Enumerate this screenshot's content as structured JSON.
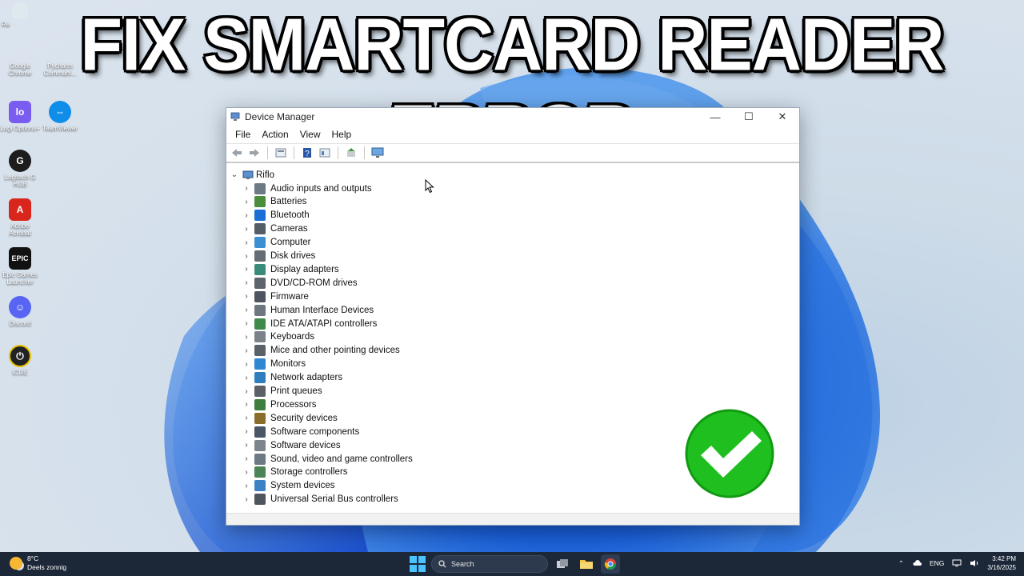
{
  "headline": "FIX SMARTCARD READER ERROR",
  "desktop_icons": [
    {
      "label": "Re",
      "icon": "recycle-bin-icon"
    },
    {
      "label": "Google Chrome",
      "icon": "chrome-icon"
    },
    {
      "label": "Pycharm Communi...",
      "icon": "pycharm-icon"
    },
    {
      "label": "Logi Options+",
      "icon": "logi-options-icon"
    },
    {
      "label": "TeamViewer",
      "icon": "teamviewer-icon"
    },
    {
      "label": "Logitech G HUB",
      "icon": "logitech-ghub-icon"
    },
    {
      "label": "Adobe Acrobat",
      "icon": "adobe-acrobat-icon"
    },
    {
      "label": "Epic Games Launcher",
      "icon": "epic-games-icon"
    },
    {
      "label": "Discord",
      "icon": "discord-icon"
    },
    {
      "label": "iCUE",
      "icon": "icue-icon"
    }
  ],
  "window": {
    "title": "Device Manager",
    "minimize": "—",
    "maximize": "☐",
    "close": "✕",
    "menu": [
      "File",
      "Action",
      "View",
      "Help"
    ],
    "root": "Riflo",
    "categories": [
      {
        "label": "Audio inputs and outputs",
        "icon": "speaker-icon",
        "color": "#6d7a86"
      },
      {
        "label": "Batteries",
        "icon": "battery-icon",
        "color": "#4a8d3c"
      },
      {
        "label": "Bluetooth",
        "icon": "bluetooth-icon",
        "color": "#1a6fd6"
      },
      {
        "label": "Cameras",
        "icon": "camera-icon",
        "color": "#555d66"
      },
      {
        "label": "Computer",
        "icon": "computer-icon",
        "color": "#3c8fd1"
      },
      {
        "label": "Disk drives",
        "icon": "disk-drive-icon",
        "color": "#666c73"
      },
      {
        "label": "Display adapters",
        "icon": "display-adapter-icon",
        "color": "#3b8b7a"
      },
      {
        "label": "DVD/CD-ROM drives",
        "icon": "dvd-drive-icon",
        "color": "#5e646b"
      },
      {
        "label": "Firmware",
        "icon": "firmware-icon",
        "color": "#4d5560"
      },
      {
        "label": "Human Interface Devices",
        "icon": "hid-icon",
        "color": "#6e7780"
      },
      {
        "label": "IDE ATA/ATAPI controllers",
        "icon": "ide-controller-icon",
        "color": "#3f8a4a"
      },
      {
        "label": "Keyboards",
        "icon": "keyboard-icon",
        "color": "#7b828a"
      },
      {
        "label": "Mice and other pointing devices",
        "icon": "mouse-icon",
        "color": "#5b6168"
      },
      {
        "label": "Monitors",
        "icon": "monitor-icon",
        "color": "#2f86d1"
      },
      {
        "label": "Network adapters",
        "icon": "network-adapter-icon",
        "color": "#2f7fbf"
      },
      {
        "label": "Print queues",
        "icon": "printer-icon",
        "color": "#5c6168"
      },
      {
        "label": "Processors",
        "icon": "processor-icon",
        "color": "#3d7d3d"
      },
      {
        "label": "Security devices",
        "icon": "security-device-icon",
        "color": "#8a6d2a"
      },
      {
        "label": "Software components",
        "icon": "software-component-icon",
        "color": "#4a5566"
      },
      {
        "label": "Software devices",
        "icon": "software-device-icon",
        "color": "#7d848c"
      },
      {
        "label": "Sound, video and game controllers",
        "icon": "sound-controller-icon",
        "color": "#6d7a86"
      },
      {
        "label": "Storage controllers",
        "icon": "storage-controller-icon",
        "color": "#4b8457"
      },
      {
        "label": "System devices",
        "icon": "system-device-icon",
        "color": "#3a82c4"
      },
      {
        "label": "Universal Serial Bus controllers",
        "icon": "usb-icon",
        "color": "#4f555c"
      }
    ]
  },
  "taskbar": {
    "weather_temp": "8°C",
    "weather_text": "Deels zonnig",
    "search_placeholder": "Search",
    "language": "ENG",
    "time": "3:42 PM",
    "date": "3/16/2025"
  },
  "colors": {
    "accent": "#0078d4",
    "check_green": "#1fbf1f",
    "taskbar_bg": "#1c2738",
    "wallpaper_blue": "#1a5fd6"
  }
}
